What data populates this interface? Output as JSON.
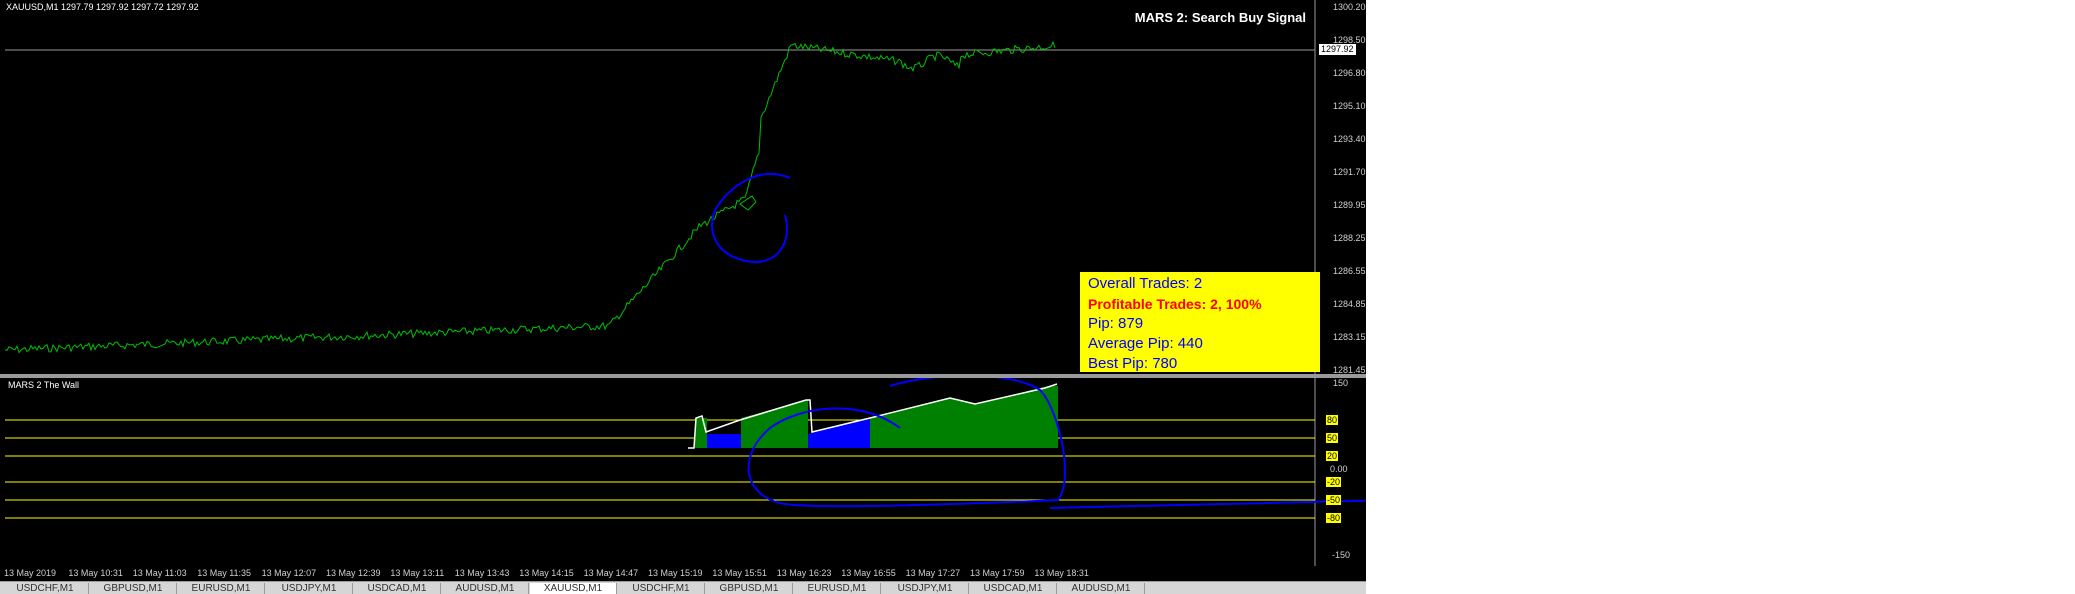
{
  "symbol_info": "XAUUSD,M1  1297.79 1297.92 1297.72 1297.92",
  "signal_title": "MARS 2: Search Buy Signal",
  "current_price_tag": "1297.92",
  "price_axis": [
    "1300.20",
    "1298.50",
    "1296.80",
    "1295.10",
    "1293.40",
    "1291.70",
    "1289.95",
    "1288.25",
    "1286.55",
    "1284.85",
    "1283.15",
    "1281.45"
  ],
  "stats": {
    "overall": "Overall Trades: 2",
    "profitable": "Profitable Trades: 2, 100%",
    "pip": "Pip: 879",
    "average": "Average Pip: 440",
    "best": "Best Pip: 780"
  },
  "indicator": {
    "title": "MARS 2 The Wall",
    "axis_150": "150",
    "axis_000": "0.00",
    "axis_m150": "-150",
    "levels": [
      "80",
      "50",
      "20",
      "-20",
      "-50",
      "-80"
    ]
  },
  "time_axis": [
    "13 May 2019",
    "13 May 10:31",
    "13 May 11:03",
    "13 May 11:35",
    "13 May 12:07",
    "13 May 12:39",
    "13 May 13:11",
    "13 May 13:43",
    "13 May 14:15",
    "13 May 14:47",
    "13 May 15:19",
    "13 May 15:51",
    "13 May 16:23",
    "13 May 16:55",
    "13 May 17:27",
    "13 May 17:59",
    "13 May 18:31"
  ],
  "tabs": [
    "USDCHF,M1",
    "GBPUSD,M1",
    "EURUSD,M1",
    "USDJPY,M1",
    "USDCAD,M1",
    "AUDUSD,M1",
    "XAUUSD,M1",
    "USDCHF,M1",
    "GBPUSD,M1",
    "EURUSD,M1",
    "USDJPY,M1",
    "USDCAD,M1",
    "AUDUSD,M1"
  ],
  "active_tab_index": 6,
  "colors": {
    "price_line": "#00c000",
    "histogram_green": "#008000",
    "histogram_blue": "#0000ff",
    "level_line": "#ffff00",
    "annotation_pen": "#0000ff",
    "stats_bg": "#ffff00"
  }
}
